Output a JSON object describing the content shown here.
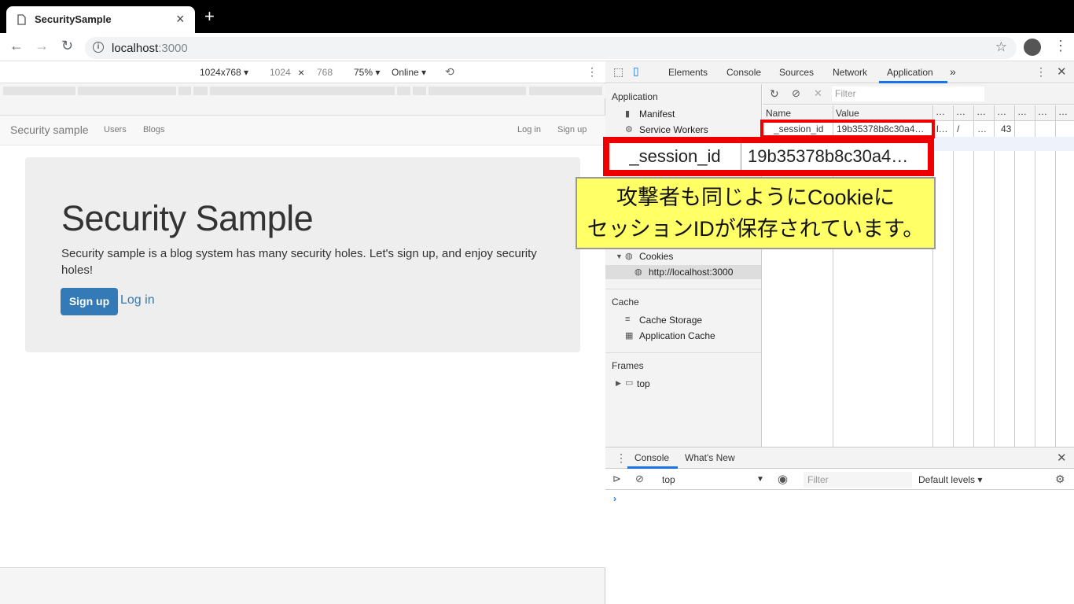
{
  "browser": {
    "tab_title": "SecuritySample",
    "url_host": "localhost",
    "url_port": ":3000"
  },
  "device_toolbar": {
    "device": "1024x768 ▾",
    "width": "1024",
    "height": "768",
    "times": "×",
    "zoom": "75% ▾",
    "network": "Online ▾"
  },
  "site": {
    "brand": "Security sample",
    "nav_left": [
      "Users",
      "Blogs"
    ],
    "nav_right": [
      "Log in",
      "Sign up"
    ],
    "heading": "Security Sample",
    "lead": "Security sample is a blog system has many security holes. Let's sign up, and enjoy security holes!",
    "signup_label": "Sign up",
    "login_label": "Log in"
  },
  "devtools": {
    "tabs": [
      "Elements",
      "Console",
      "Sources",
      "Network",
      "Application",
      "»"
    ],
    "active_tab": "Application",
    "sidebar": {
      "application_header": "Application",
      "manifest": "Manifest",
      "service_workers": "Service Workers",
      "cookies": "Cookies",
      "cookie_origin": "http://localhost:3000",
      "cache_header": "Cache",
      "cache_storage": "Cache Storage",
      "application_cache": "Application Cache",
      "frames_header": "Frames",
      "frame_top": "top"
    },
    "cookie_filter_placeholder": "Filter",
    "cookie_columns": [
      "Name",
      "Value",
      "…",
      "…",
      "…",
      "…",
      "…",
      "…",
      "…"
    ],
    "cookie_row": {
      "name": "_session_id",
      "value": "19b35378b8c30a4…",
      "domain": "l…",
      "path": "/",
      "expires": "…",
      "size": "43"
    },
    "drawer_tabs": [
      "Console",
      "What's New"
    ],
    "console_context": "top",
    "console_filter_placeholder": "Filter",
    "levels": "Default levels ▾",
    "prompt": "›"
  },
  "annotation": {
    "zoom_name": "_session_id",
    "zoom_value": "19b35378b8c30a4…",
    "callout_line1": "攻撃者も同じようにCookieに",
    "callout_line2": "セッションIDが保存されています。"
  },
  "colors": {
    "accent": "#337ab7",
    "highlight_red": "#ee0000",
    "callout_yellow": "#ffff66",
    "devtools_active": "#1a73e8"
  }
}
